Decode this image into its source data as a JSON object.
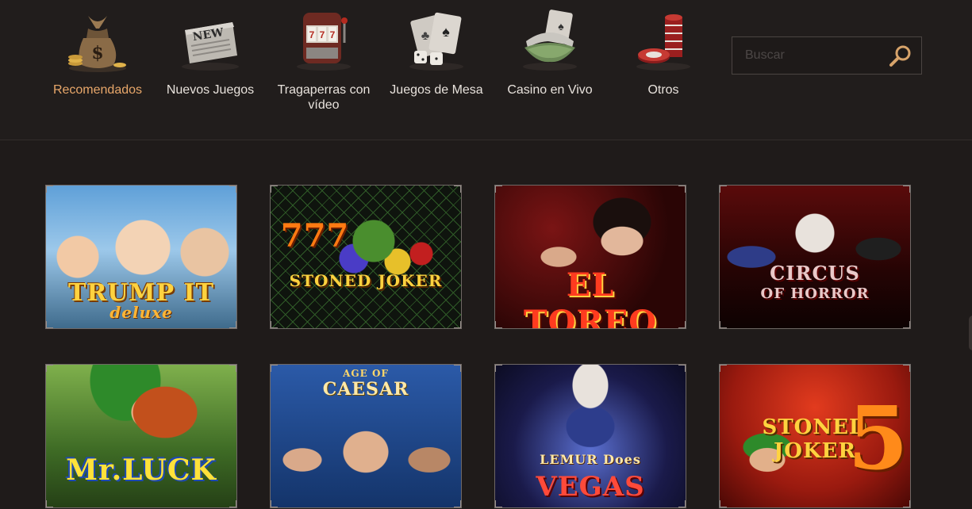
{
  "nav": {
    "categories": [
      {
        "label": "Recomendados",
        "icon": "money-bag-icon",
        "active": true
      },
      {
        "label": "Nuevos Juegos",
        "icon": "newspaper-icon",
        "active": false,
        "icon_text": "NEW"
      },
      {
        "label": "Tragaperras con vídeo",
        "icon": "slot-machine-icon",
        "active": false
      },
      {
        "label": "Juegos de Mesa",
        "icon": "cards-dice-icon",
        "active": false
      },
      {
        "label": "Casino en Vivo",
        "icon": "dealer-visor-icon",
        "active": false
      },
      {
        "label": "Otros",
        "icon": "chips-icon",
        "active": false
      }
    ],
    "active_color": "#e8a76a",
    "text_color": "#e8e2dc"
  },
  "search": {
    "placeholder": "Buscar",
    "icon": "magnifier-icon",
    "icon_color": "#d7a36a"
  },
  "games": [
    {
      "title": "TRUMP IT",
      "subtitle": "deluxe"
    },
    {
      "title": "STONED JOKER",
      "subtitle": "777"
    },
    {
      "title": "EL TOREO",
      "subtitle": ""
    },
    {
      "title": "CIRCUS",
      "subtitle": "OF HORROR"
    },
    {
      "title": "Mr.LUCK",
      "subtitle": ""
    },
    {
      "title": "CAESAR",
      "subtitle": "AGE OF"
    },
    {
      "title": "VEGAS",
      "subtitle": "LEMUR Does"
    },
    {
      "title": "STONED JOKER",
      "subtitle": "5"
    }
  ]
}
